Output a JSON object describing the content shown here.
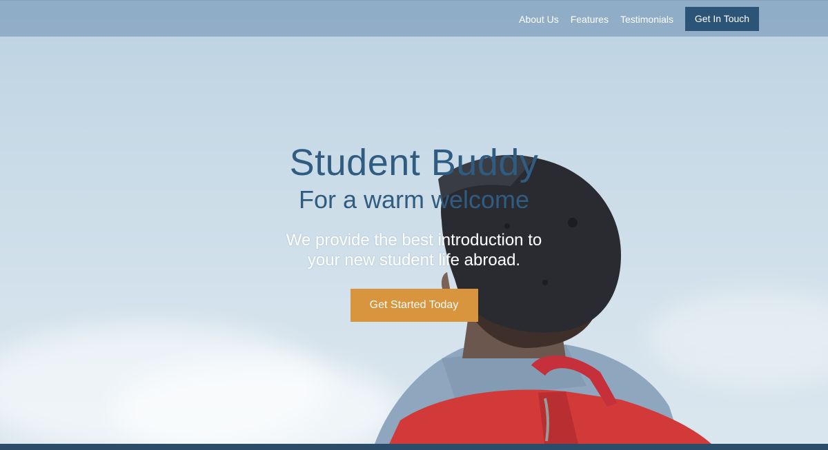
{
  "nav": {
    "links": [
      {
        "label": "About Us"
      },
      {
        "label": "Features"
      },
      {
        "label": "Testimonials"
      }
    ],
    "cta_label": "Get In Touch"
  },
  "hero": {
    "title": "Student Buddy",
    "subtitle": "For a warm welcome",
    "description": "We provide the best introduction to your new student life abroad.",
    "button_label": "Get Started Today"
  },
  "colors": {
    "primary": "#2c5477",
    "accent": "#d8953d",
    "heading": "#2f5c80"
  }
}
